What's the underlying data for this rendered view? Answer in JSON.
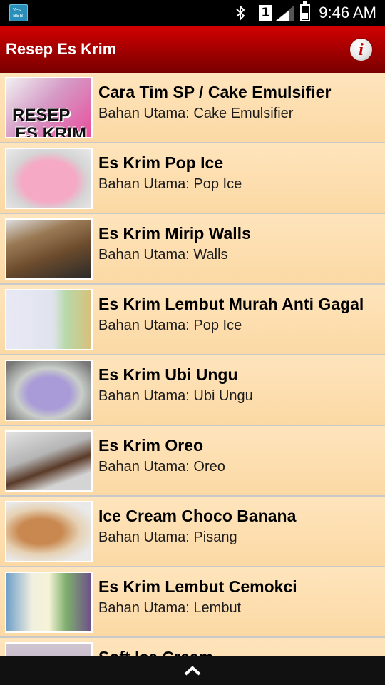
{
  "status_bar": {
    "app_icon_text_1": "Yes",
    "app_icon_text_2": "BBB",
    "sim_number": "1",
    "time": "9:46 AM",
    "icons": [
      "app-notification-icon",
      "bluetooth-icon",
      "sim-card-icon",
      "signal-icon",
      "battery-icon"
    ]
  },
  "app_bar": {
    "title": "Resep Es Krim",
    "info_icon": "i",
    "accent_color": "#b80000"
  },
  "recipes": [
    {
      "title": "Cara Tim SP / Cake Emulsifier",
      "subtitle": "Bahan Utama: Cake Emulsifier",
      "thumb_text_1": "RESEP",
      "thumb_text_2": "ES KRIM"
    },
    {
      "title": "Es Krim Pop Ice",
      "subtitle": "Bahan Utama: Pop Ice"
    },
    {
      "title": "Es Krim Mirip Walls",
      "subtitle": "Bahan Utama: Walls"
    },
    {
      "title": "Es Krim Lembut Murah Anti Gagal",
      "subtitle": "Bahan Utama: Pop Ice"
    },
    {
      "title": "Es Krim Ubi Ungu",
      "subtitle": "Bahan Utama: Ubi Ungu"
    },
    {
      "title": "Es Krim Oreo",
      "subtitle": "Bahan Utama: Oreo"
    },
    {
      "title": "Ice Cream Choco Banana",
      "subtitle": "Bahan Utama: Pisang"
    },
    {
      "title": "Es Krim Lembut Cemokci",
      "subtitle": "Bahan Utama: Lembut"
    },
    {
      "title": "Soft Ice Cream",
      "subtitle": ""
    }
  ],
  "bottom_bar": {
    "icon": "chevron-up-icon"
  }
}
